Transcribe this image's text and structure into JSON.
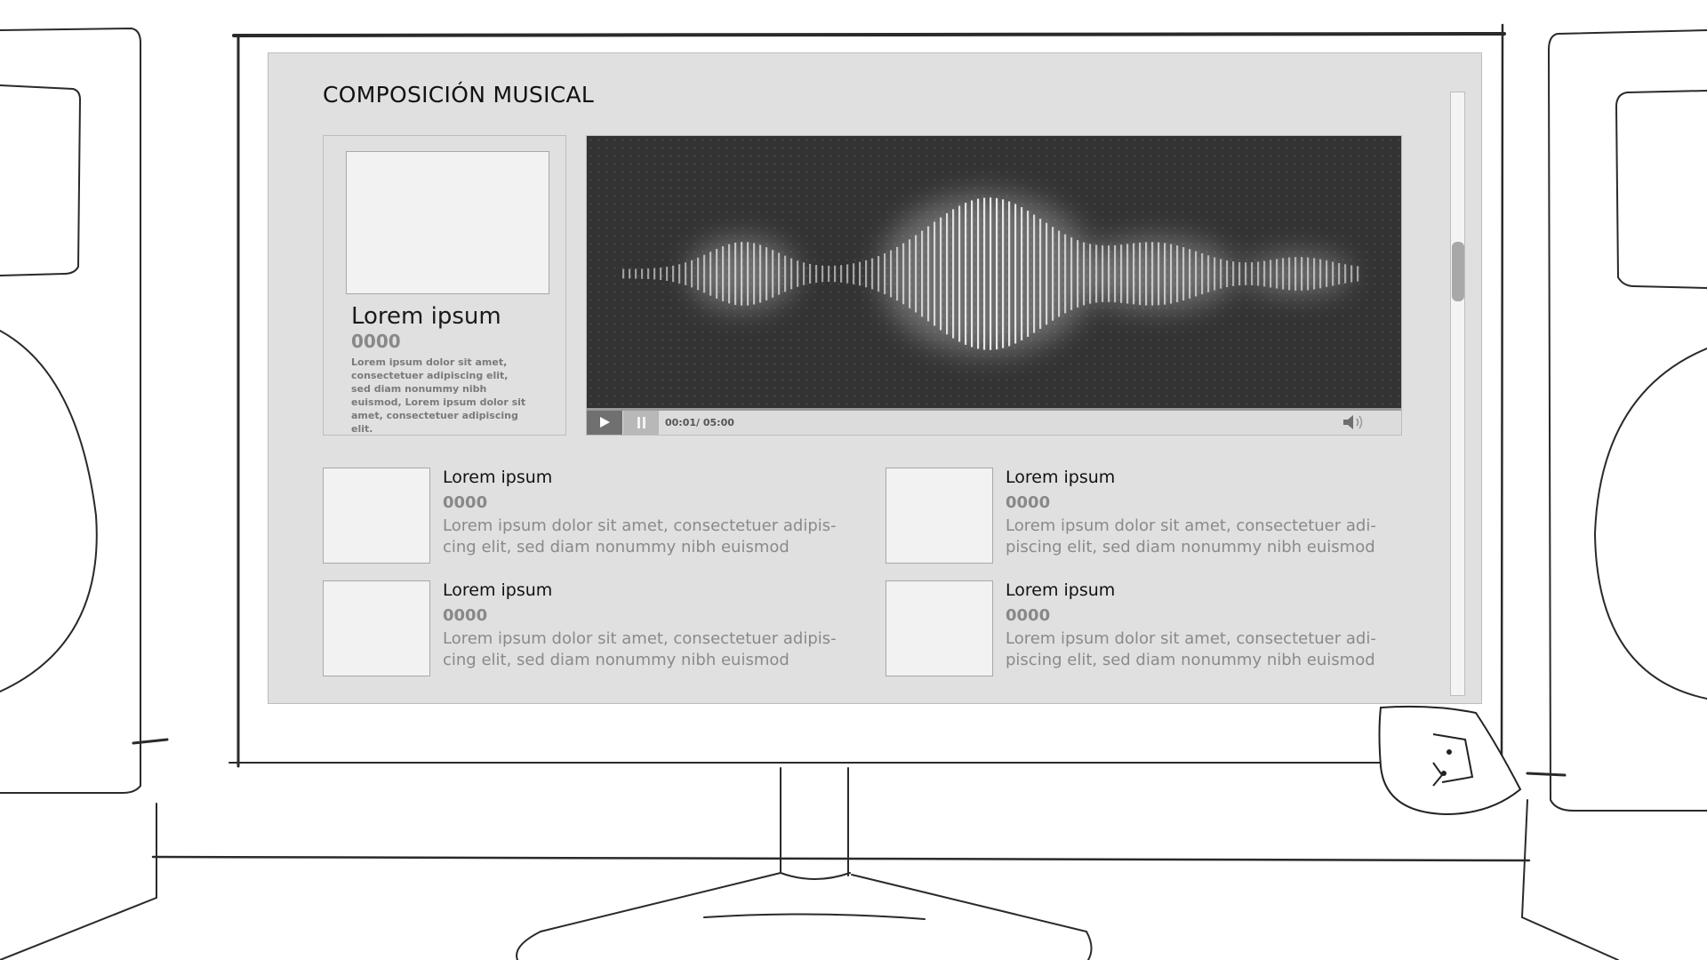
{
  "page": {
    "title": "COMPOSICIÓN MUSICAL"
  },
  "featured": {
    "title": "Lorem ipsum",
    "number": "0000",
    "description": "Lorem ipsum dolor sit amet, consectetuer adipiscing elit, sed diam nonummy nibh euismod, Lorem ipsum dolor sit amet, consectetuer adipiscing elit."
  },
  "player": {
    "time": "00:01/ 05:00",
    "progress": 0.003,
    "play_icon": "play-icon",
    "pause_icon": "pause-icon",
    "volume_icon": "volume-icon"
  },
  "items": [
    {
      "title": "Lorem ipsum",
      "number": "0000",
      "description": "Lorem ipsum dolor sit amet, consectetuer adipis-cing elit, sed diam nonummy nibh euismod"
    },
    {
      "title": "Lorem ipsum",
      "number": "0000",
      "description": "Lorem ipsum dolor sit amet, consectetuer adi-piscing elit, sed diam nonummy nibh euismod"
    },
    {
      "title": "Lorem ipsum",
      "number": "0000",
      "description": "Lorem ipsum dolor sit amet, consectetuer adipis-cing elit, sed diam nonummy nibh euismod"
    },
    {
      "title": "Lorem ipsum",
      "number": "0000",
      "description": "Lorem ipsum dolor sit amet, consectetuer adi-piscing elit, sed diam nonummy nibh euismod"
    }
  ],
  "colors": {
    "panel": "#e0e0e0",
    "visualizer": "#333333",
    "accent": "#707070"
  }
}
